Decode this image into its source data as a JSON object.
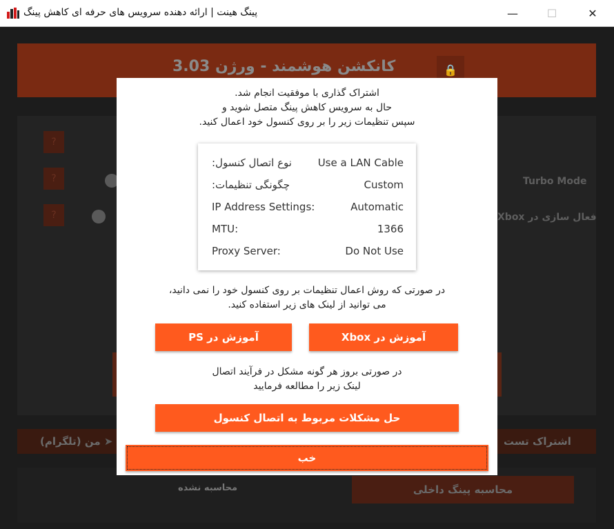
{
  "window": {
    "title": "پینگ هینت | ارائه دهنده سرویس های حرفه ای کاهش پینگ",
    "minimize": "—",
    "maximize": "☐",
    "close": "✕"
  },
  "background": {
    "header_title": "کانکشن هوشمند - ورژن 3.03",
    "help_mark": "?",
    "turbo_label": "Turbo Mode",
    "xbox_label": "فعال سازی در Xbox",
    "share_label": "اشتراک تست",
    "telegram_label": "من (تلگرام)",
    "calc_button": "محاسبه پینگ داخلی",
    "calc_status": "محاسبه نشده"
  },
  "dialog": {
    "intro_lines": [
      "اشتراک گذاری با موفقیت انجام شد.",
      "حال به سرویس کاهش پینگ متصل شوید و",
      "سپس تنظیمات زیر را بر روی کنسول خود اعمال کنید."
    ],
    "settings": [
      {
        "key": "نوع اتصال کنسول:",
        "value": "Use a LAN Cable"
      },
      {
        "key": "چگونگی تنظیمات:",
        "value": "Custom"
      },
      {
        "key": "IP Address Settings:",
        "value": "Automatic"
      },
      {
        "key": "MTU:",
        "value": "1366"
      },
      {
        "key": "Proxy Server:",
        "value": "Do Not Use"
      }
    ],
    "help_lines": [
      "در صورتی که روش اعمال تنظیمات بر روی کنسول خود را نمی دانید،",
      "می توانید از لینک های زیر استفاده کنید."
    ],
    "ps_button": "آموزش در PS",
    "xbox_button": "آموزش در Xbox",
    "problem_lines": [
      "در صورتی بروز هر گونه مشکل در فرآیند اتصال",
      "لینک زیر را مطالعه فرمایید"
    ],
    "troubleshoot_button": "حل مشکلات مربوط به اتصال کنسول",
    "ok_button": "خب"
  },
  "colors": {
    "accent": "#ff5a1e",
    "dim_accent": "#7a2a12"
  }
}
